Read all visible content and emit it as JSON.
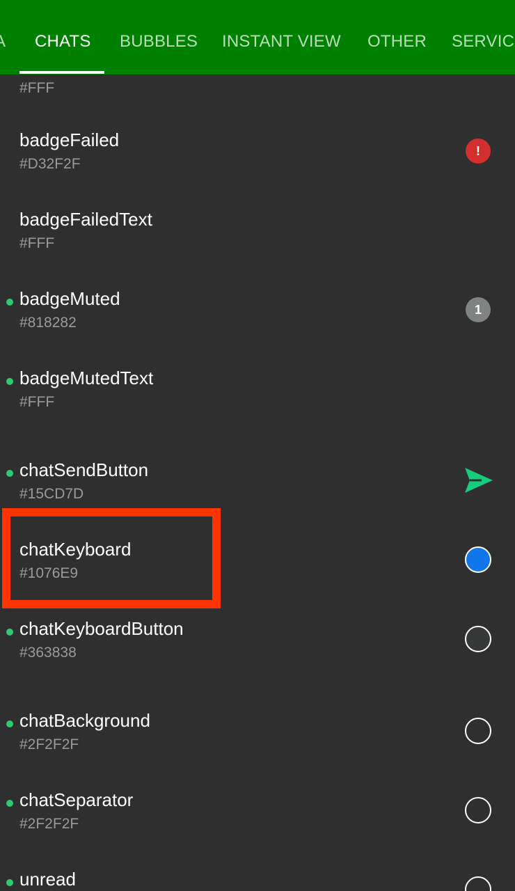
{
  "tabs": {
    "items": [
      {
        "label": "A"
      },
      {
        "label": "CHATS",
        "active": true
      },
      {
        "label": "BUBBLES"
      },
      {
        "label": "INSTANT VIEW"
      },
      {
        "label": "OTHER"
      },
      {
        "label": "SERVICE"
      }
    ]
  },
  "colors": {
    "tabbar_bg": "#008000",
    "list_bg": "#2F2F2F",
    "highlight": "#FF3300",
    "modified_dot": "#2ECC71"
  },
  "list": {
    "items": [
      {
        "name": "",
        "value": "#FFF",
        "modified": false,
        "preview": "none"
      },
      {
        "name": "badgeFailed",
        "value": "#D32F2F",
        "modified": false,
        "preview": "badge",
        "badge_text": "!",
        "color": "#D32F2F"
      },
      {
        "name": "badgeFailedText",
        "value": "#FFF",
        "modified": false,
        "preview": "none"
      },
      {
        "name": "badgeMuted",
        "value": "#818282",
        "modified": true,
        "preview": "badge",
        "badge_text": "1",
        "color": "#818282"
      },
      {
        "name": "badgeMutedText",
        "value": "#FFF",
        "modified": true,
        "preview": "none"
      },
      {
        "name": "chatSendButton",
        "value": "#15CD7D",
        "modified": true,
        "preview": "send-icon",
        "color": "#15CD7D"
      },
      {
        "name": "chatKeyboard",
        "value": "#1076E9",
        "modified": false,
        "preview": "swatch",
        "color": "#1076E9",
        "highlighted": true
      },
      {
        "name": "chatKeyboardButton",
        "value": "#363838",
        "modified": true,
        "preview": "swatch",
        "color": "#363838"
      },
      {
        "name": "chatBackground",
        "value": "#2F2F2F",
        "modified": true,
        "preview": "swatch",
        "color": "#2F2F2F"
      },
      {
        "name": "chatSeparator",
        "value": "#2F2F2F",
        "modified": true,
        "preview": "swatch",
        "color": "#2F2F2F"
      },
      {
        "name": "unread",
        "value": "",
        "modified": true,
        "preview": "swatch",
        "color": "#2F2F2F"
      }
    ]
  }
}
